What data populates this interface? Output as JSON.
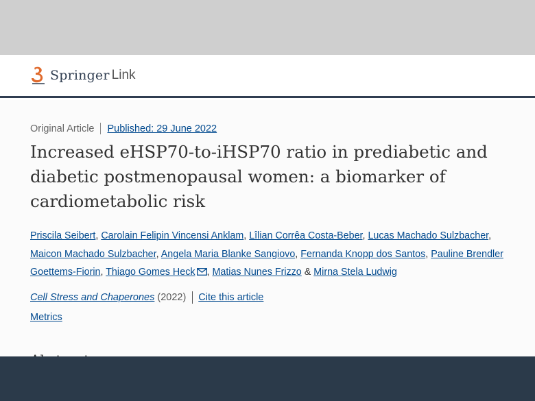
{
  "header": {
    "brand_primary": "Springer",
    "brand_secondary": "Link"
  },
  "article": {
    "type": "Original Article",
    "published": "Published: 29 June 2022",
    "title": "Increased eHSP70-to-iHSP70 ratio in prediabetic and diabetic postmenopausal women: a biomarker of cardiometabolic risk",
    "authors": [
      "Priscila Seibert",
      "Carolain Felipin Vincensi Anklam",
      "Lîlian Corrêa Costa-Beber",
      "Lucas Machado Sulzbacher",
      "Maicon Machado Sulzbacher",
      "Angela Maria Blanke Sangiovo",
      "Fernanda Knopp dos Santos",
      "Pauline Brendler Goettems-Fiorin",
      "Thiago Gomes Heck",
      "Matias Nunes Frizzo",
      "Mirna Stela Ludwig"
    ],
    "journal": "Cell Stress and Chaperones",
    "year": "(2022)",
    "cite_label": "Cite this article",
    "metrics_label": "Metrics",
    "abstract_heading": "Abstract"
  },
  "colors": {
    "link": "#024a8f",
    "brand": "#303e51",
    "footer": "#2b3a4a"
  }
}
